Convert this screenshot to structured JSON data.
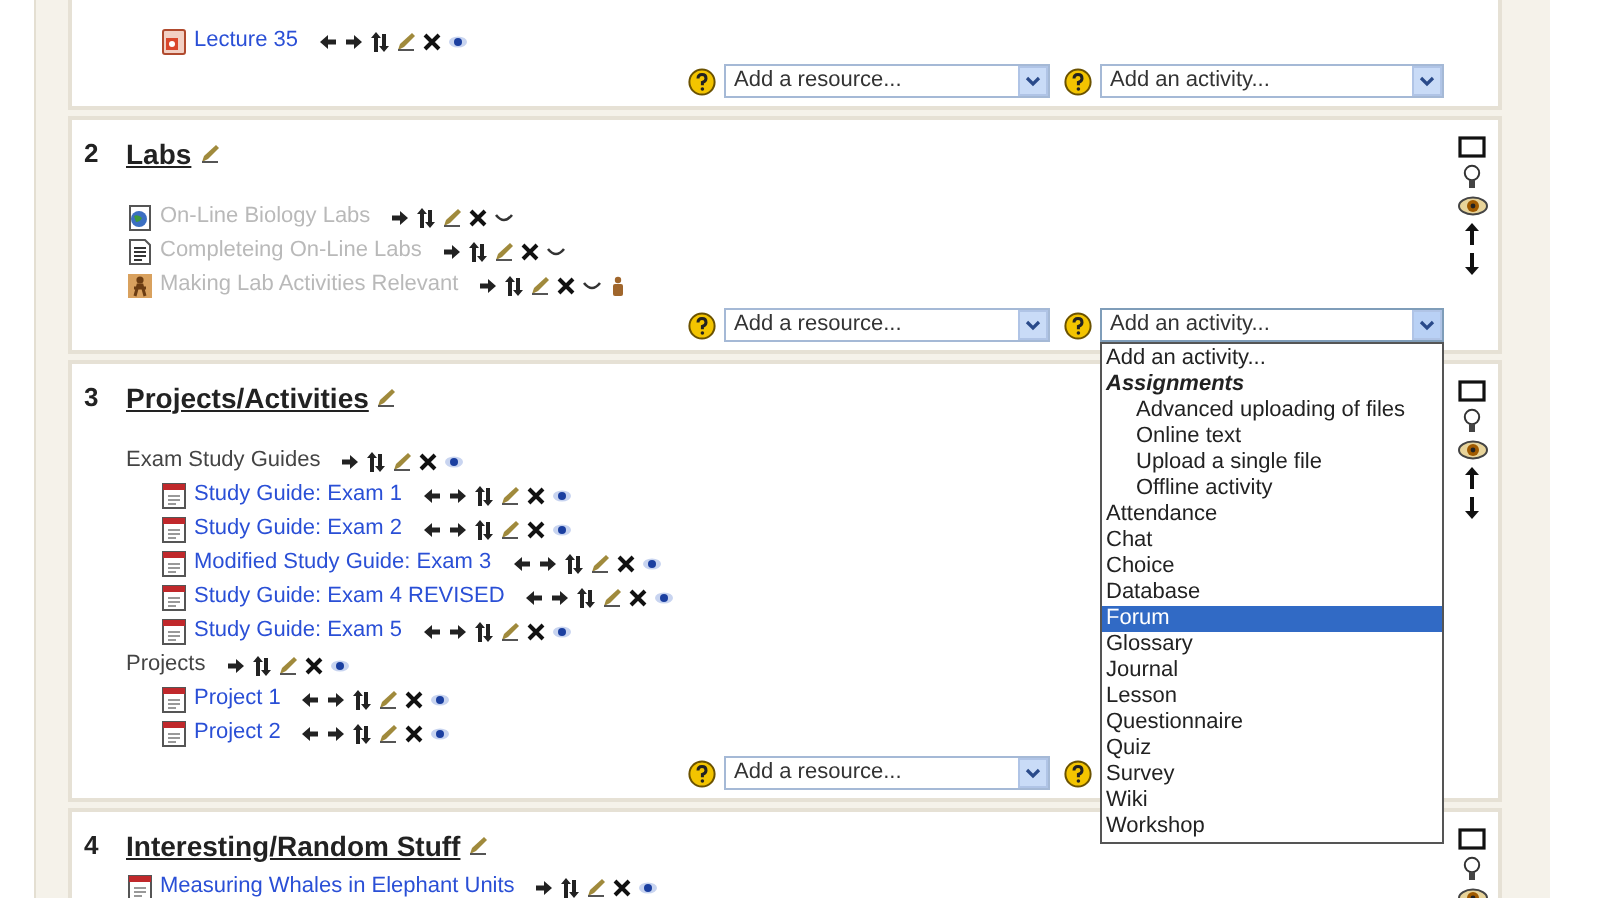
{
  "sections": [
    {
      "items": [
        {
          "children": [
            {
              "kind": "slides",
              "label": "Lecture 35",
              "hidden": false
            }
          ]
        }
      ],
      "adders": [
        {
          "kind": "resource",
          "label": "Add a resource..."
        },
        {
          "kind": "activity",
          "label": "Add an activity..."
        }
      ]
    },
    {
      "number": "2",
      "title": "Labs",
      "items": [
        {
          "kind": "web-page",
          "label": "On-Line Biology Labs",
          "hidden": true
        },
        {
          "kind": "text-page",
          "label": "Completeing On-Line Labs",
          "hidden": true
        },
        {
          "kind": "activity",
          "label": "Making Lab Activities Relevant",
          "hidden": true
        }
      ],
      "adders": [
        {
          "kind": "resource",
          "label": "Add a resource..."
        },
        {
          "kind": "activity",
          "label": "Add an activity...",
          "expanded": true,
          "options": [
            {
              "label": "Add an activity...",
              "selected": false
            },
            {
              "label": "Assignments",
              "kind": "group",
              "selected": false,
              "children": [
                {
                  "label": "Advanced uploading of files",
                  "selected": false
                },
                {
                  "label": "Online text",
                  "selected": false
                },
                {
                  "label": "Upload a single file",
                  "selected": false
                },
                {
                  "label": "Offline activity",
                  "selected": false
                }
              ]
            },
            {
              "label": "Attendance",
              "selected": false
            },
            {
              "label": "Chat",
              "selected": false
            },
            {
              "label": "Choice",
              "selected": false
            },
            {
              "label": "Database",
              "selected": false
            },
            {
              "label": "Forum",
              "selected": true
            },
            {
              "label": "Glossary",
              "selected": false
            },
            {
              "label": "Journal",
              "selected": false
            },
            {
              "label": "Lesson",
              "selected": false
            },
            {
              "label": "Questionnaire",
              "selected": false
            },
            {
              "label": "Quiz",
              "selected": false
            },
            {
              "label": "Survey",
              "selected": false
            },
            {
              "label": "Wiki",
              "selected": false
            },
            {
              "label": "Workshop",
              "selected": false
            }
          ]
        }
      ]
    },
    {
      "number": "3",
      "title": "Projects/Activities",
      "items": [
        {
          "kind": "label",
          "label": "Exam Study Guides",
          "hidden": false,
          "children": [
            {
              "kind": "pdf",
              "label": "Study Guide: Exam 1",
              "hidden": false
            },
            {
              "kind": "pdf",
              "label": "Study Guide: Exam 2",
              "hidden": false
            },
            {
              "kind": "pdf",
              "label": "Modified Study Guide: Exam 3",
              "hidden": false
            },
            {
              "kind": "pdf",
              "label": "Study Guide: Exam 4 REVISED",
              "hidden": false
            },
            {
              "kind": "pdf",
              "label": "Study Guide: Exam 5",
              "hidden": false
            }
          ]
        },
        {
          "kind": "label",
          "label": "Projects",
          "hidden": false,
          "children": [
            {
              "kind": "pdf",
              "label": "Project 1",
              "hidden": false
            },
            {
              "kind": "pdf",
              "label": "Project 2",
              "hidden": false
            }
          ]
        }
      ],
      "adders": [
        {
          "kind": "resource",
          "label": "Add a resource..."
        },
        {
          "kind": "help-only"
        }
      ]
    },
    {
      "number": "4",
      "title": "Interesting/Random Stuff",
      "items": [
        {
          "kind": "pdf",
          "label": "Measuring Whales in Elephant Units",
          "hidden": false
        }
      ]
    }
  ]
}
